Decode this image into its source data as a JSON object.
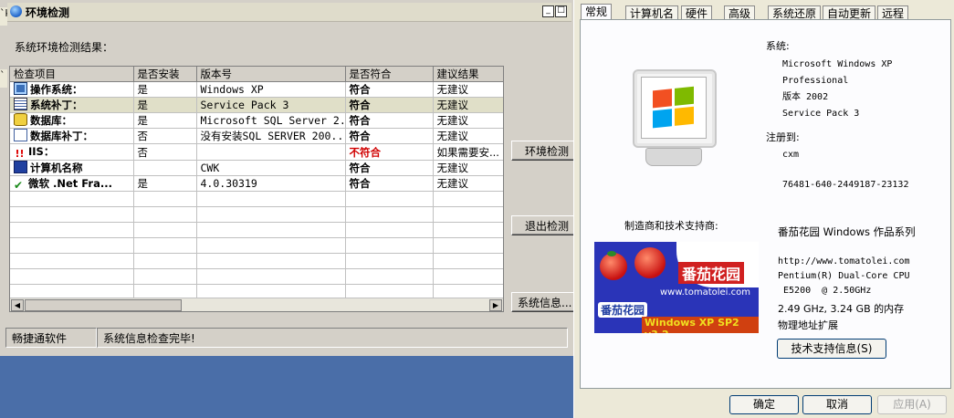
{
  "env_window": {
    "title": "环境检测",
    "results_label": "系统环境检测结果：",
    "left_stub": [
      "`k",
      "`"
    ],
    "columns": [
      "检查项目",
      "是否安装",
      "版本号",
      "是否符合",
      "建议结果"
    ],
    "rows": [
      {
        "icon": "computer-icon",
        "item": "操作系统：",
        "installed": "是",
        "version": "Windows XP",
        "match": "符合",
        "suggestion": "无建议"
      },
      {
        "icon": "list-icon",
        "item": "系统补丁：",
        "installed": "是",
        "version": "Service Pack 3",
        "match": "符合",
        "suggestion": "无建议"
      },
      {
        "icon": "database-icon",
        "item": "数据库：",
        "installed": "是",
        "version": "Microsoft SQL Server 2...",
        "match": "符合",
        "suggestion": "无建议"
      },
      {
        "icon": "document-icon",
        "item": "数据库补丁：",
        "installed": "否",
        "version": "没有安装SQL SERVER 200...",
        "match": "符合",
        "suggestion": "无建议"
      },
      {
        "icon": "warning-icon",
        "item": "IIS：",
        "installed": "否",
        "version": "",
        "match": "不符合",
        "suggestion": "如果需要安..."
      },
      {
        "icon": "monitor-icon",
        "item": "计算机名称",
        "installed": "",
        "version": "CWK",
        "match": "符合",
        "suggestion": "无建议"
      },
      {
        "icon": "checkmark-icon",
        "item": "微软 .Net Fra...",
        "installed": "是",
        "version": "4.0.30319",
        "match": "符合",
        "suggestion": "无建议"
      }
    ],
    "empty_rows": 8,
    "buttons": {
      "check": "环境检测",
      "exit": "退出检测",
      "sysinfo": "系统信息..."
    },
    "status": {
      "app": "畅捷通软件",
      "message": "系统信息检查完毕!"
    }
  },
  "sys_props": {
    "tabs": [
      "常规",
      "计算机名",
      "硬件",
      "高级",
      "系统还原",
      "自动更新",
      "远程"
    ],
    "active_tab": 0,
    "system_label": "系统:",
    "os_lines": [
      "Microsoft Windows XP",
      "Professional",
      "版本 2002",
      "Service Pack 3"
    ],
    "registered_label": "注册到:",
    "user": "cxm",
    "serial": "76481-640-2449187-23132",
    "manufacturer_label": "制造商和技术支持商:",
    "vendor": "番茄花园 Windows 作品系列",
    "url": "http://www.tomatolei.com",
    "cpu_line1": "Pentium(R) Dual-Core  CPU",
    "cpu_line2": " E5200  @ 2.50GHz",
    "cpu_line3": "2.49 GHz, 3.24 GB 的内存",
    "pae": "物理地址扩展",
    "tech_button": "技术支持信息(S)",
    "banner": {
      "title": "番茄花园",
      "url": "www.tomatolei.com",
      "pill": "番茄花园",
      "version": "Windows XP SP2 v3.2"
    },
    "buttons": {
      "ok": "确定",
      "cancel": "取消",
      "apply": "应用(A)"
    }
  }
}
